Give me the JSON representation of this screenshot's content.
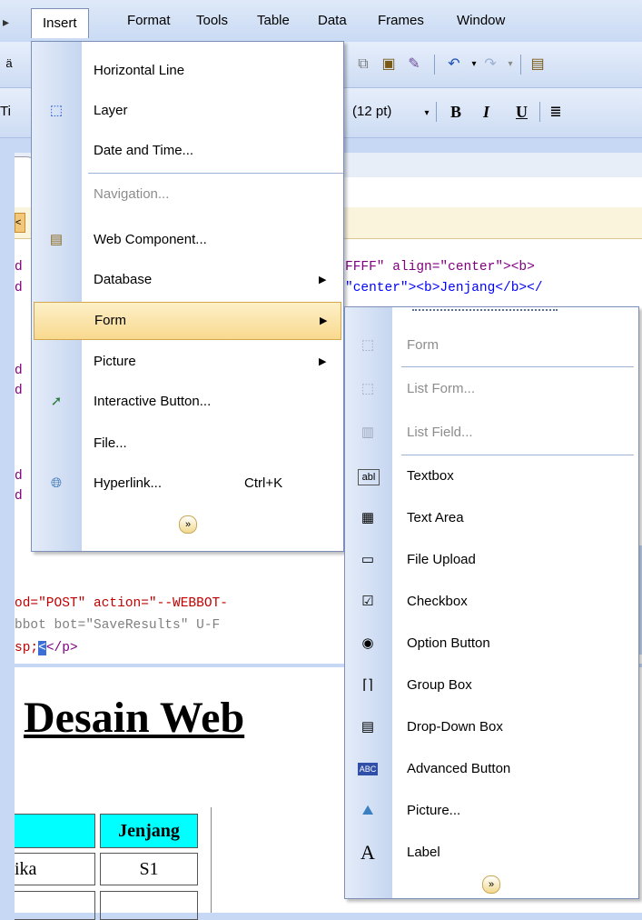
{
  "menubar": {
    "items": [
      "Insert",
      "Format",
      "Tools",
      "Table",
      "Data",
      "Frames",
      "Window"
    ]
  },
  "toolbar": {
    "font_name": "Ti",
    "font_size": "(12 pt)",
    "bold": "B",
    "italic": "I",
    "underline": "U"
  },
  "code": {
    "line1_a": "d",
    "line1_b": "FFFF\" align=\"center\"><b>",
    "line2_a": "d",
    "line2_b": "\"center\"><b>Jenjang</b></",
    "line3": "d",
    "line4": "d",
    "line5": "d",
    "line6": "d",
    "line7_a": "od=\"POST\" action=\"--WEBBOT-",
    "line8": "bbot bot=\"SaveResults\" U-F",
    "line9_a": "sp;",
    "line9_b": "</p>"
  },
  "preview": {
    "heading": "Desain Web",
    "table_header": "Jenjang",
    "cell1": "ika",
    "cell2": "S1"
  },
  "insert_menu": {
    "items": [
      {
        "label": "Horizontal Line",
        "icon": "horizontal-line-icon"
      },
      {
        "label": "Layer",
        "icon": "layer-icon"
      },
      {
        "label": "Date and Time...",
        "icon": ""
      },
      {
        "label": "Navigation...",
        "icon": ""
      },
      {
        "label": "Web Component...",
        "icon": "web-component-icon"
      },
      {
        "label": "Database",
        "icon": ""
      },
      {
        "label": "Form",
        "icon": ""
      },
      {
        "label": "Picture",
        "icon": ""
      },
      {
        "label": "Interactive Button...",
        "icon": "interactive-button-icon"
      },
      {
        "label": "File...",
        "icon": ""
      },
      {
        "label": "Hyperlink...",
        "icon": "hyperlink-icon",
        "shortcut": "Ctrl+K"
      }
    ]
  },
  "form_menu": {
    "items": [
      {
        "label": "Form",
        "icon": "form-icon"
      },
      {
        "label": "List Form...",
        "icon": "list-form-icon"
      },
      {
        "label": "List Field...",
        "icon": "list-field-icon"
      },
      {
        "label": "Textbox",
        "icon": "textbox-icon"
      },
      {
        "label": "Text Area",
        "icon": "text-area-icon"
      },
      {
        "label": "File Upload",
        "icon": "file-upload-icon"
      },
      {
        "label": "Checkbox",
        "icon": "checkbox-icon"
      },
      {
        "label": "Option Button",
        "icon": "option-button-icon"
      },
      {
        "label": "Group Box",
        "icon": "group-box-icon"
      },
      {
        "label": "Drop-Down Box",
        "icon": "drop-down-box-icon"
      },
      {
        "label": "Advanced Button",
        "icon": "advanced-button-icon"
      },
      {
        "label": "Picture...",
        "icon": "picture-icon"
      },
      {
        "label": "Label",
        "icon": "label-icon"
      }
    ]
  }
}
